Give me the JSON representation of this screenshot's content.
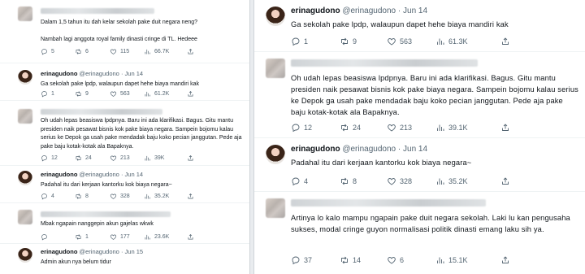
{
  "left": {
    "tweets": [
      {
        "text_lines": [
          "Dalam 1,5 tahun itu dah kelar sekolah pake duit negara neng?",
          "",
          "Nambah lagi anggota royal family dinasti cringe di TL. Hedeee"
        ],
        "replies": "5",
        "retweets": "6",
        "likes": "115",
        "views": "66.7K"
      },
      {
        "name": "erinagudono",
        "handle": "@erinagudono",
        "dot": "·",
        "date": "Jun 14",
        "text": "Ga sekolah pake lpdp, walaupun dapet hehe biaya mandiri kak",
        "replies": "1",
        "retweets": "9",
        "likes": "563",
        "views": "61.2K"
      },
      {
        "text": "Oh udah lepas beasiswa lpdpnya. Baru ini ada klarifikasi. Bagus. Gitu mantu presiden naik pesawat bisnis kok pake biaya negara. Sampein bojomu kalau serius ke Depok ga usah pake mendadak baju koko pecian janggutan. Pede aja pake baju kotak-kotak ala Bapaknya.",
        "replies": "12",
        "retweets": "24",
        "likes": "213",
        "views": "39K"
      },
      {
        "name": "erinagudono",
        "handle": "@erinagudono",
        "dot": "·",
        "date": "Jun 14",
        "text": "Padahal itu dari kerjaan kantorku kok biaya negara~",
        "replies": "4",
        "retweets": "8",
        "likes": "328",
        "views": "35.2K"
      },
      {
        "text": "Mbak ngapain nanggepin akun gajelas wkwk",
        "replies": "",
        "retweets": "1",
        "likes": "177",
        "views": "23.6K"
      },
      {
        "name": "erinagudono",
        "handle": "@erinagudono",
        "dot": "·",
        "date": "Jun 15",
        "text": "Admin akun nya belum tidur"
      }
    ]
  },
  "right": {
    "tweets": [
      {
        "name": "erinagudono",
        "handle": "@erinagudono",
        "dot": "·",
        "date": "Jun 14",
        "text": "Ga sekolah pake lpdp, walaupun dapet hehe biaya mandiri kak",
        "replies": "1",
        "retweets": "9",
        "likes": "563",
        "views": "61.3K"
      },
      {
        "text": "Oh udah lepas beasiswa lpdpnya. Baru ini ada klarifikasi. Bagus. Gitu mantu presiden naik pesawat bisnis kok pake biaya negara. Sampein bojomu kalau serius ke Depok ga usah pake mendadak baju koko pecian janggutan. Pede aja pake baju kotak-kotak ala Bapaknya.",
        "replies": "12",
        "retweets": "24",
        "likes": "213",
        "views": "39.1K"
      },
      {
        "name": "erinagudono",
        "handle": "@erinagudono",
        "dot": "·",
        "date": "Jun 14",
        "text": "Padahal itu dari kerjaan kantorku kok biaya negara~",
        "replies": "4",
        "retweets": "8",
        "likes": "328",
        "views": "35.2K"
      },
      {
        "text": "Artinya lo kalo mampu ngapain pake duit negara sekolah. Laki lu kan pengusaha sukses, modal cringe guyon normalisasi politik dinasti emang laku sih ya.",
        "replies": "37",
        "retweets": "14",
        "likes": "6",
        "views": "15.1K"
      }
    ]
  }
}
